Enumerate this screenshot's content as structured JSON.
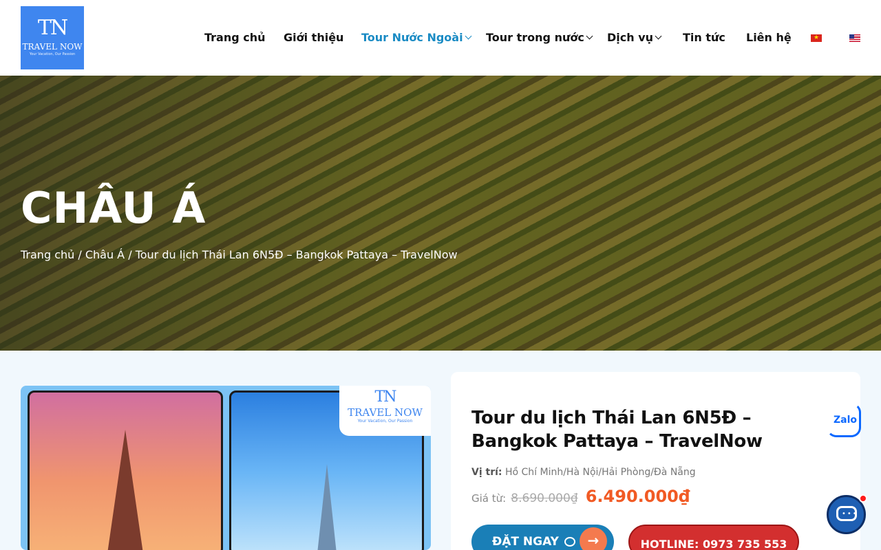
{
  "brand": {
    "logo_monogram": "TN",
    "logo_name": "TRAVEL NOW",
    "logo_tagline": "Your Vacation, Our Passion"
  },
  "nav": {
    "items": [
      {
        "label": "Trang chủ",
        "has_dropdown": false,
        "active": false
      },
      {
        "label": "Giới thiệu",
        "has_dropdown": false,
        "active": false
      },
      {
        "label": "Tour Nước Ngoài",
        "has_dropdown": true,
        "active": true
      },
      {
        "label": "Tour trong nước",
        "has_dropdown": true,
        "active": false
      },
      {
        "label": "Dịch vụ",
        "has_dropdown": true,
        "active": false
      },
      {
        "label": "Tin tức",
        "has_dropdown": false,
        "active": false
      },
      {
        "label": "Liên hệ",
        "has_dropdown": false,
        "active": false
      }
    ],
    "languages": [
      "vi-flag-icon",
      "en-flag-icon"
    ],
    "active_color": "#1a8bc4"
  },
  "hero": {
    "title": "CHÂU Á",
    "breadcrumb": [
      "Trang chủ",
      "Châu Á",
      "Tour du lịch Thái Lan 6N5Đ – Bangkok Pattaya – TravelNow"
    ],
    "separator": " / "
  },
  "tour": {
    "title": "Tour du lịch Thái Lan 6N5Đ – Bangkok Pattaya – TravelNow",
    "location_label": "Vị trí:",
    "location_value": "Hồ Chí Minh/Hà Nội/Hải Phòng/Đà Nẵng",
    "price_label": "Giá từ:",
    "price_old": "8.690.000₫",
    "price_new": "6.490.000₫",
    "book_label": "ĐẶT NGAY",
    "hotline_label": "HOTLINE: 0973 735 553"
  },
  "floating": {
    "zalo_label": "Zalo"
  },
  "colors": {
    "primary": "#1a7fb7",
    "price": "#f15a24",
    "hotline": "#d32f2f"
  }
}
